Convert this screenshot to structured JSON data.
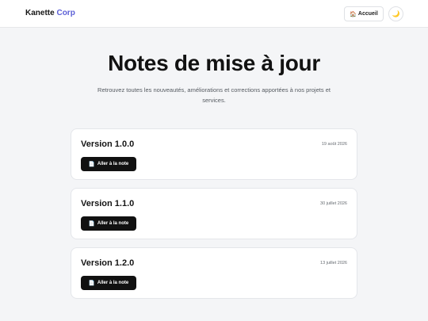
{
  "header": {
    "brand_main": "Kanette",
    "brand_accent": "Corp",
    "home_icon": "🏠",
    "home_label": "Accueil",
    "theme_icon": "🌙"
  },
  "hero": {
    "title": "Notes de mise à jour",
    "subtitle": "Retrouvez toutes les nouveautés, améliorations et corrections apportées à nos projets et services."
  },
  "releases": [
    {
      "version": "Version 1.0.0",
      "date": "19 août 2026",
      "button_icon": "📄",
      "button_label": "Aller à la note"
    },
    {
      "version": "Version 1.1.0",
      "date": "30 juillet 2026",
      "button_icon": "📄",
      "button_label": "Aller à la note"
    },
    {
      "version": "Version 1.2.0",
      "date": "13 juillet 2026",
      "button_icon": "📄",
      "button_label": "Aller à la note"
    }
  ],
  "colors": {
    "accent": "#5b5fd6",
    "button_bg": "#111111",
    "page_bg": "#f4f5f7"
  }
}
